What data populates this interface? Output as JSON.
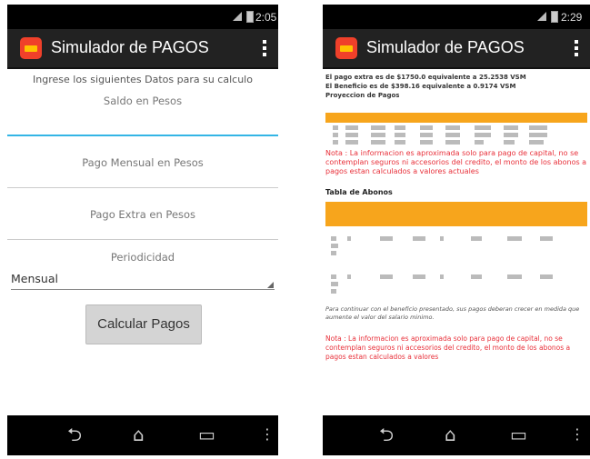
{
  "left": {
    "status_time": "2:05",
    "app_title": "Simulador de PAGOS",
    "intro": "Ingrese los siguientes Datos para su calculo",
    "fields": {
      "saldo": "Saldo en Pesos",
      "pago_mensual": "Pago Mensual en Pesos",
      "pago_extra": "Pago Extra en Pesos",
      "periodicidad": "Periodicidad"
    },
    "period_value": "Mensual",
    "calc_button": "Calcular Pagos"
  },
  "right": {
    "status_time": "2:29",
    "app_title": "Simulador de PAGOS",
    "summary_1": "El pago extra es de $1750.0 equivalente a 25.2538 VSM",
    "summary_2": "El Beneficio es de $398.16 equivalente a 0.9174 VSM",
    "summary_3": "Proyeccion de Pagos",
    "note_1": "Nota : La informacion es aproximada solo para pago de capital, no se contemplan seguros ni accesorios del credito, el monto de los abonos a pagos estan calculados a valores actuales",
    "section_title": "Tabla de Abonos",
    "footer": "Para continuar con el beneficio presentado, sus pagos deberan crecer en medida que aumente el valor del salario minimo.",
    "note_2": "Nota : La informacion es aproximada solo para pago de capital, no se contemplan seguros ni accesorios del credito, el monto de los abonos a pagos estan calculados a valores"
  },
  "nav": {
    "back": "⮌",
    "home": "⌂",
    "recent": "▭",
    "menu": "⋮"
  },
  "colors": {
    "accent": "#33b5e5",
    "table_header": "#f7a51c",
    "note_red": "#e8303a",
    "action_bar": "#222222"
  }
}
